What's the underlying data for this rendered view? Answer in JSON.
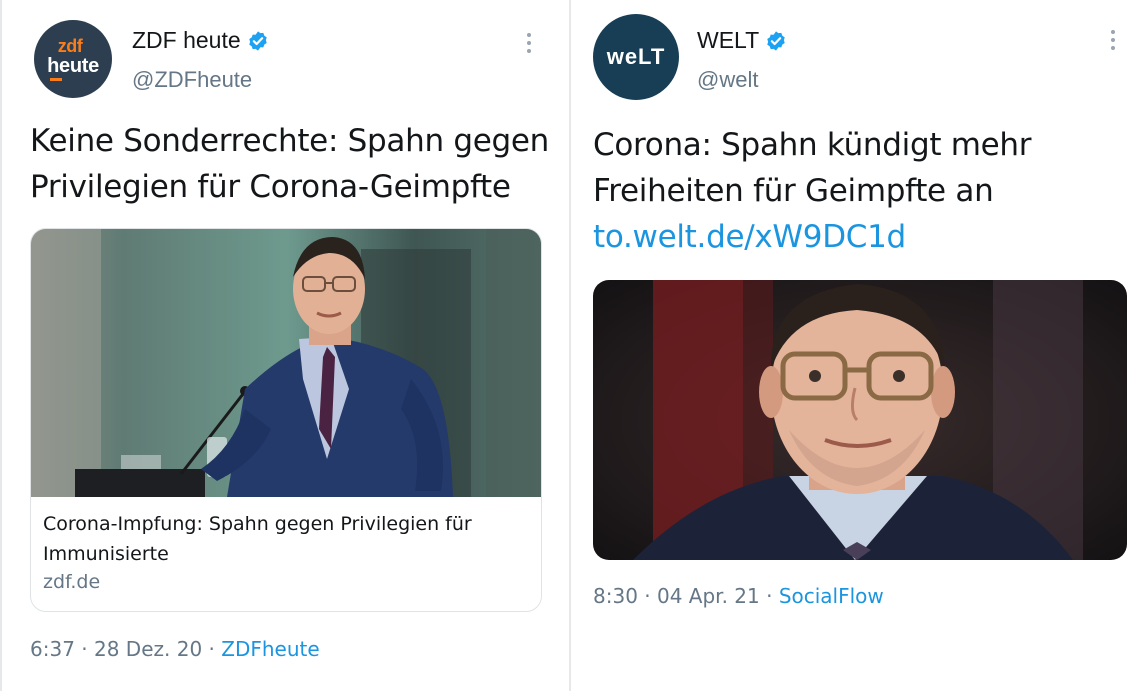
{
  "tweets": [
    {
      "author": {
        "name": "ZDF heute",
        "handle": "@ZDFheute",
        "avatar_line1": "zdf",
        "avatar_line2": "heute"
      },
      "text": "Keine Sonderrechte: Spahn gegen Privilegien für Corona-Geimpfte",
      "card": {
        "title": "Corona-Impfung: Spahn gegen Privilegien für Immunisierte",
        "domain": "zdf.de"
      },
      "meta": {
        "time": "6:37",
        "date": "28 Dez. 20",
        "source": "ZDFheute",
        "separator": "·"
      }
    },
    {
      "author": {
        "name": "WELT",
        "handle": "@welt",
        "avatar_line1": "weLT"
      },
      "text": "Corona: Spahn kündigt mehr Freiheiten für Geimpfte an",
      "link": "to.welt.de/xW9DC1d",
      "meta": {
        "time": "8:30",
        "date": "04 Apr. 21",
        "source": "SocialFlow",
        "separator": "·"
      }
    }
  ],
  "icons": {
    "verified": "verified-badge-icon",
    "more": "more-vertical-icon"
  },
  "colors": {
    "link": "#1b95e0",
    "verified": "#1da1f2",
    "secondary_text": "#657786",
    "zdf_orange": "#fa7d19",
    "welt_navy": "#173e55"
  }
}
